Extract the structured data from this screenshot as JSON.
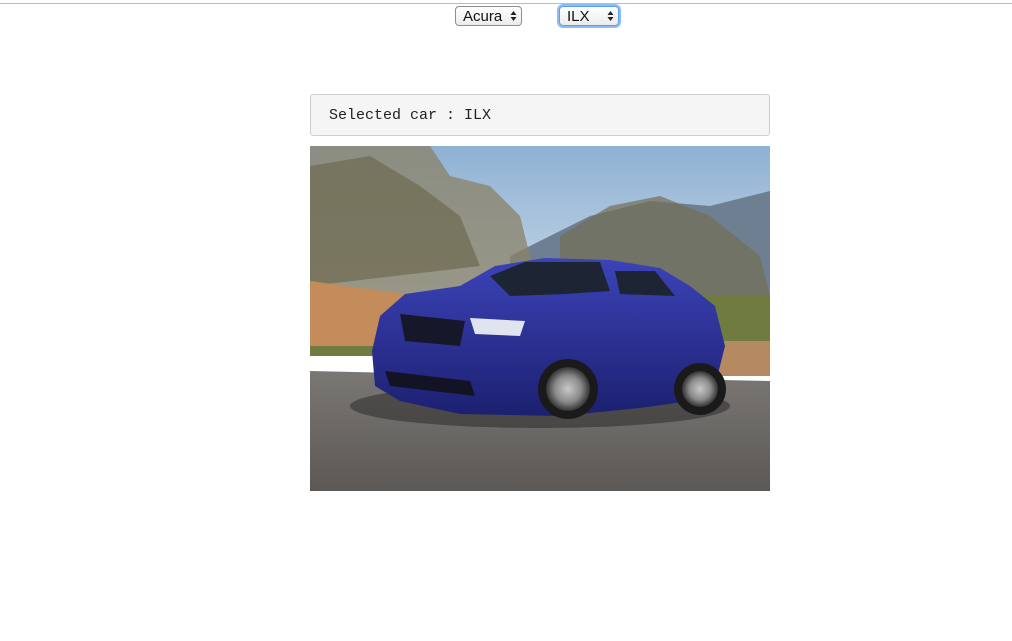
{
  "make_select": {
    "value": "Acura"
  },
  "model_select": {
    "value": "ILX"
  },
  "selection": {
    "label": "Selected car : ",
    "value": "ILX"
  },
  "photo": {
    "subject": "blue sedan on road",
    "car_color": "#2a2f9a"
  }
}
